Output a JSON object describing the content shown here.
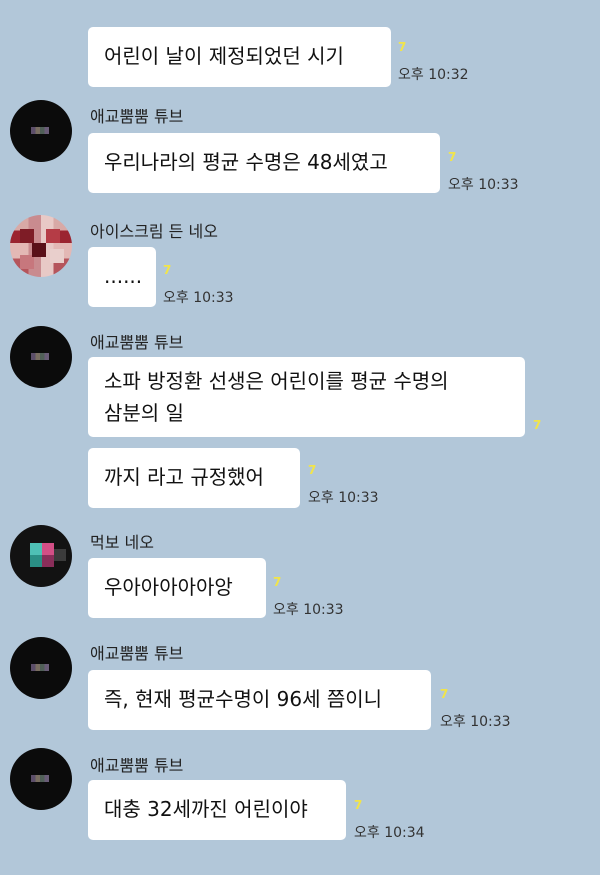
{
  "messages": [
    {
      "sender": "",
      "text": "어린이 날이 제정되었던 시기",
      "unread": "7",
      "time": "오후 10:32"
    },
    {
      "sender": "애교뿜뿜 튜브",
      "text": "우리나라의 평균 수명은 48세였고",
      "unread": "7",
      "time": "오후 10:33"
    },
    {
      "sender": "아이스크림 든 네오",
      "text": "......",
      "unread": "7",
      "time": "오후 10:33"
    },
    {
      "sender": "애교뿜뿜 튜브",
      "text_line1": "소파 방정환 선생은 어린이를 평균 수명의",
      "text_line2": "삼분의 일",
      "unread": "7"
    },
    {
      "sender": "",
      "text": "까지 라고 규정했어",
      "unread": "7",
      "time": "오후 10:33"
    },
    {
      "sender": "먹보 네오",
      "text": "우아아아아아앙",
      "unread": "7",
      "time": "오후 10:33"
    },
    {
      "sender": "애교뿜뿜 튜브",
      "text": "즉, 현재 평균수명이 96세 쯤이니",
      "unread": "7",
      "time": "오후 10:33"
    },
    {
      "sender": "애교뿜뿜 튜브",
      "text": "대충 32세까진 어린이야",
      "unread": "7",
      "time": "오후 10:34"
    }
  ]
}
